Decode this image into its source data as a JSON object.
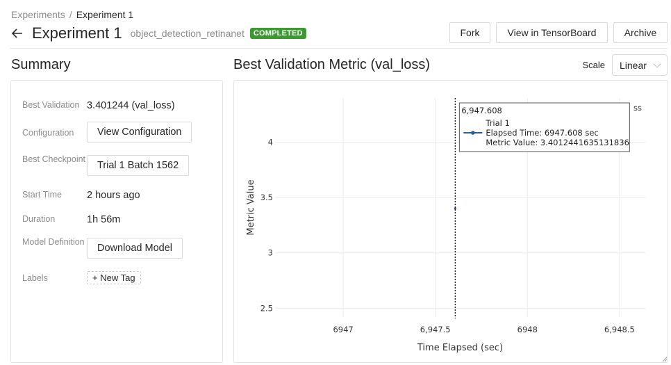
{
  "breadcrumb": {
    "items": [
      "Experiments",
      "Experiment 1"
    ],
    "separator": "/"
  },
  "header": {
    "title": "Experiment 1",
    "description": "object_detection_retinanet",
    "status": "COMPLETED",
    "status_color": "#3b9a2f",
    "actions": {
      "fork": "Fork",
      "tensorboard": "View in TensorBoard",
      "archive": "Archive"
    }
  },
  "summary": {
    "title": "Summary",
    "rows": {
      "best_validation": {
        "label": "Best Validation",
        "value": "3.401244 (val_loss)"
      },
      "configuration": {
        "label": "Configuration",
        "button": "View Configuration"
      },
      "best_checkpoint": {
        "label": "Best Checkpoint",
        "button": "Trial 1 Batch 1562"
      },
      "start_time": {
        "label": "Start Time",
        "value": "2 hours ago"
      },
      "duration": {
        "label": "Duration",
        "value": "1h 56m"
      },
      "model_definition": {
        "label": "Model Definition",
        "button": "Download Model"
      },
      "labels": {
        "label": "Labels",
        "button": "+ New Tag"
      }
    }
  },
  "chart_panel": {
    "title": "Best Validation Metric (val_loss)",
    "scale_label": "Scale",
    "scale_value": "Linear"
  },
  "chart_data": {
    "type": "line",
    "title": "Best Validation Metric (val_loss)",
    "xlabel": "Time Elapsed (sec)",
    "ylabel": "Metric Value",
    "xlim": [
      6946.63,
      6948.64
    ],
    "ylim": [
      2.42,
      4.4
    ],
    "x_ticks": [
      6947,
      6947.5,
      6948,
      6948.5
    ],
    "x_tick_labels": [
      "6947",
      "6,947.5",
      "6948",
      "6,948.5"
    ],
    "y_ticks": [
      2.5,
      3,
      3.5,
      4
    ],
    "y_tick_labels": [
      "2.5",
      "3",
      "3.5",
      "4"
    ],
    "grid": true,
    "legend": {
      "position": "top-right",
      "entries": [
        "val_loss"
      ],
      "visible_text": "ss"
    },
    "series": [
      {
        "name": "Trial 1",
        "color": "#1f5fa8",
        "x": [
          6947.608
        ],
        "y": [
          3.4012441635131836
        ]
      }
    ],
    "hover": {
      "x": 6947.608,
      "header": "6,947.608",
      "series_name": "Trial 1",
      "line1": "Elapsed Time: 6947.608 sec",
      "line2": "Metric Value: 3.4012441635131836"
    }
  }
}
